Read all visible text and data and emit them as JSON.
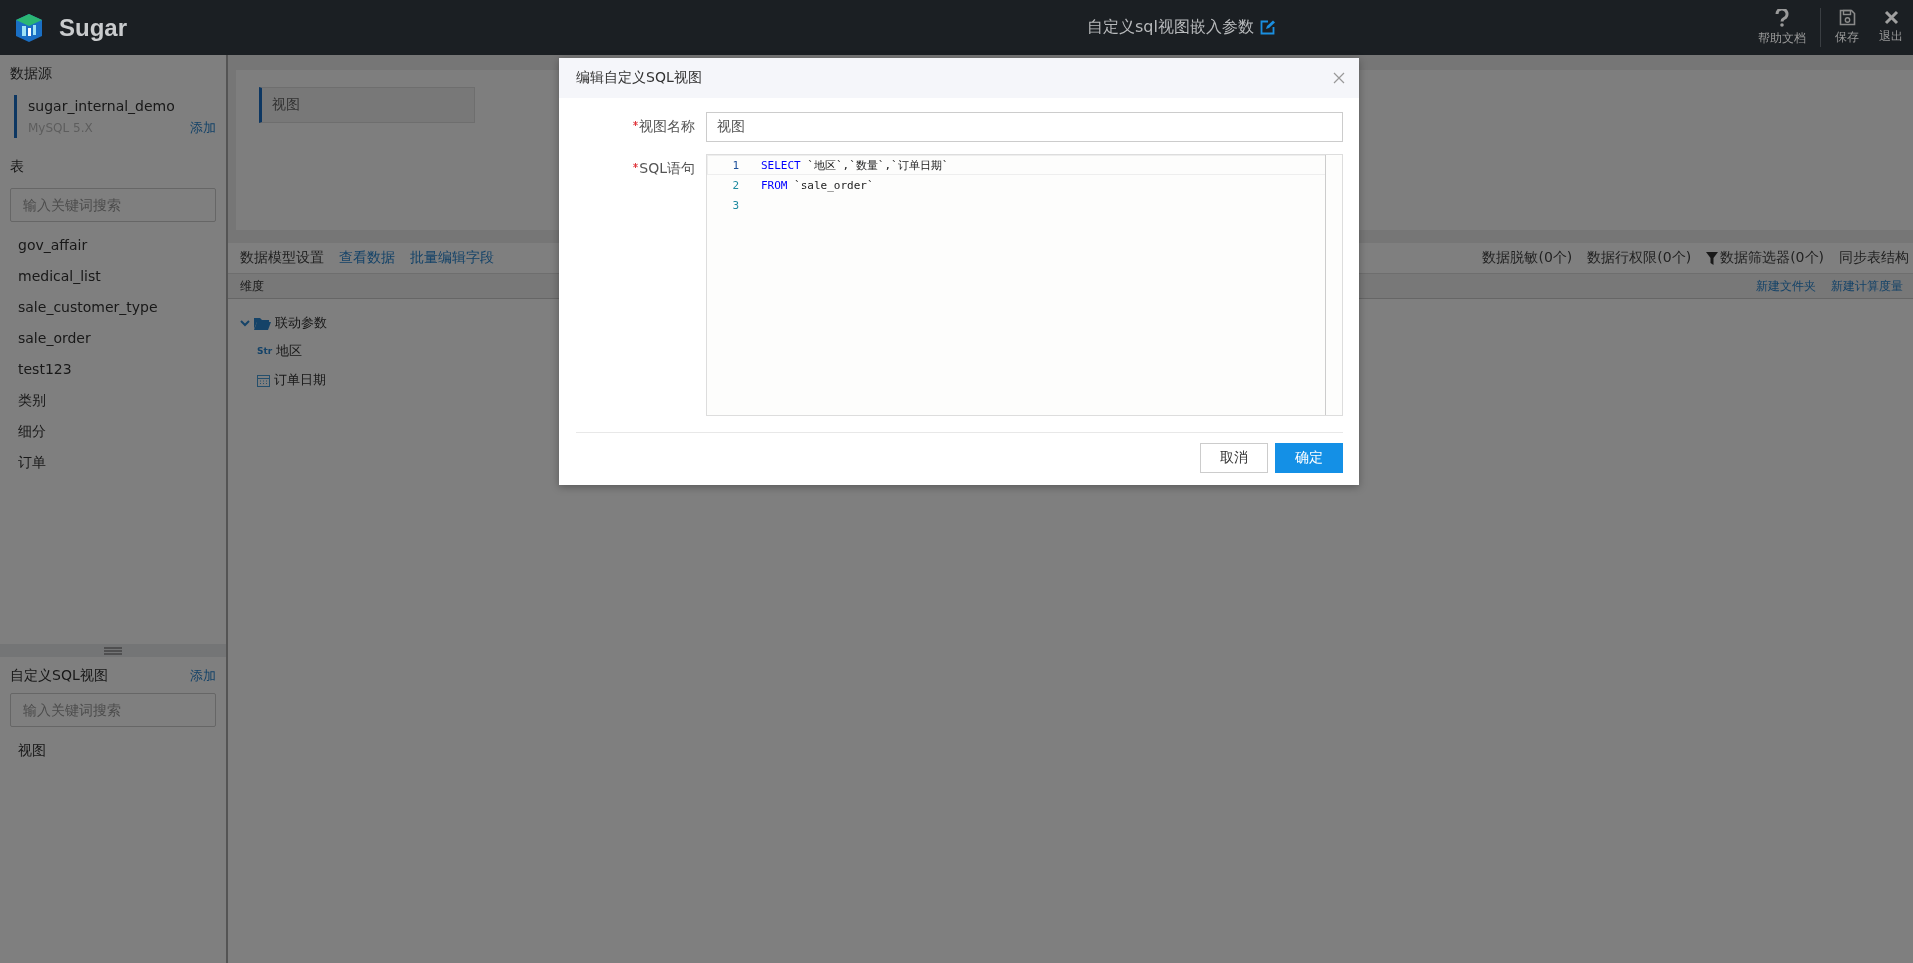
{
  "topbar": {
    "brand": "Sugar",
    "title": "自定义sql视图嵌入参数",
    "actions": [
      {
        "label": "帮助文档",
        "kind": "help"
      },
      {
        "label": "保存",
        "kind": "save"
      },
      {
        "label": "退出",
        "kind": "exit"
      }
    ]
  },
  "sidebar": {
    "datasource_heading": "数据源",
    "datasource": {
      "name": "sugar_internal_demo",
      "type": "MySQL 5.X",
      "add": "添加"
    },
    "tables_heading": "表",
    "tables_search": {
      "placeholder": "输入关键词搜索"
    },
    "tables": [
      "gov_affair",
      "medical_list",
      "sale_customer_type",
      "sale_order",
      "test123",
      "类别",
      "细分",
      "订单"
    ],
    "views_heading": "自定义SQL视图",
    "views_add": "添加",
    "views_search": {
      "placeholder": "输入关键词搜索"
    },
    "views": [
      "视图"
    ]
  },
  "main": {
    "view_tab": "视图",
    "toolbar_left": [
      {
        "label": "数据模型设置",
        "kind": "text"
      },
      {
        "label": "查看数据",
        "kind": "link"
      },
      {
        "label": "批量编辑字段",
        "kind": "link"
      }
    ],
    "toolbar_right": [
      {
        "label": "数据脱敏(0个)",
        "kind": "plain"
      },
      {
        "label": "数据行权限(0个)",
        "kind": "plain"
      },
      {
        "label": "数据筛选器(0个)",
        "kind": "filter"
      },
      {
        "label": "同步表结构",
        "kind": "plain"
      }
    ],
    "dimension_header": "维度",
    "header_actions": [
      "新建文件夹",
      "新建计算度量"
    ],
    "tree": [
      {
        "label": "联动参数",
        "kind": "folder",
        "expanded": true,
        "children": [
          {
            "label": "地区",
            "kind": "string",
            "type_tag": "Str"
          },
          {
            "label": "订单日期",
            "kind": "date"
          }
        ]
      }
    ]
  },
  "dialog": {
    "title": "编辑自定义SQL视图",
    "fields": [
      {
        "label": "视图名称",
        "required": true,
        "kind": "input",
        "value": "视图"
      },
      {
        "label": "SQL语句",
        "required": true,
        "kind": "code",
        "lines": [
          {
            "number": "1",
            "active": true,
            "tokens": [
              {
                "kind": "keyword",
                "text": "SELECT"
              },
              {
                "kind": "text",
                "text": " `地区`,`数量`,`订单日期`"
              }
            ]
          },
          {
            "number": "2",
            "active": false,
            "tokens": [
              {
                "kind": "keyword",
                "text": "FROM"
              },
              {
                "kind": "text",
                "text": " `sale_order`"
              }
            ]
          },
          {
            "number": "3",
            "active": false
          }
        ]
      }
    ],
    "buttons": [
      {
        "label": "取消",
        "kind": "secondary"
      },
      {
        "label": "确定",
        "kind": "primary"
      }
    ]
  }
}
